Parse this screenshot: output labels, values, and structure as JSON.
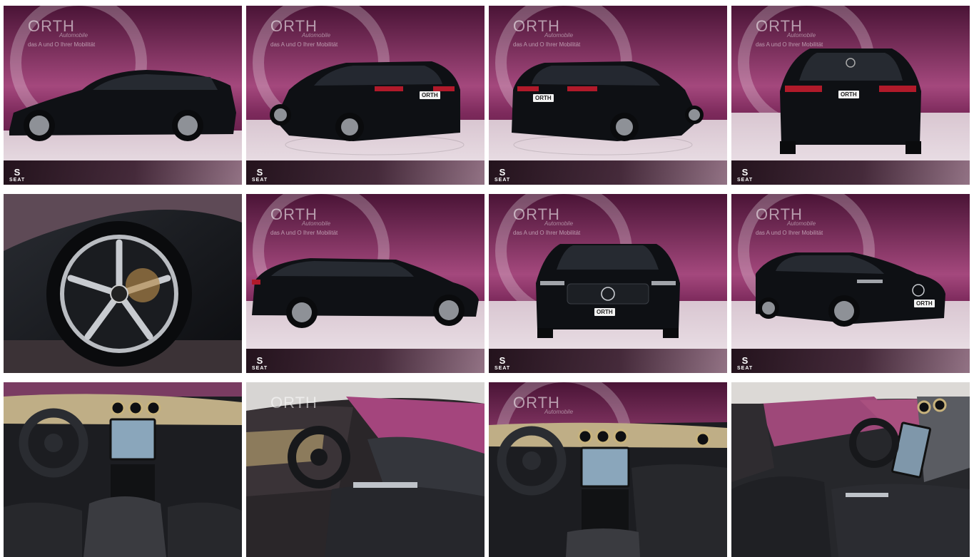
{
  "watermark": {
    "brand": "ORTH",
    "sub": "Automobile",
    "tagline": "das A und O Ihrer Mobilität"
  },
  "dealer_logo": {
    "mark": "S",
    "name": "SEAT"
  },
  "plate_text": "ORTH",
  "colors": {
    "backdrop_top": "#5a1c42",
    "backdrop_mid": "#a1447a",
    "backdrop_light": "#d8a1c0",
    "floor": "#e8dde4",
    "car": "#101216",
    "rim": "#b9bcc1",
    "taillight": "#b11a2a"
  },
  "tiles": [
    {
      "view": "side-profile-left"
    },
    {
      "view": "rear-three-quarter-left"
    },
    {
      "view": "rear-three-quarter-right"
    },
    {
      "view": "rear"
    },
    {
      "view": "wheel-closeup"
    },
    {
      "view": "side-profile-right"
    },
    {
      "view": "front"
    },
    {
      "view": "front-three-quarter-right"
    },
    {
      "view": "cockpit-dashboard"
    },
    {
      "view": "driver-door-interior"
    },
    {
      "view": "dashboard-center"
    },
    {
      "view": "passenger-side-interior"
    }
  ]
}
